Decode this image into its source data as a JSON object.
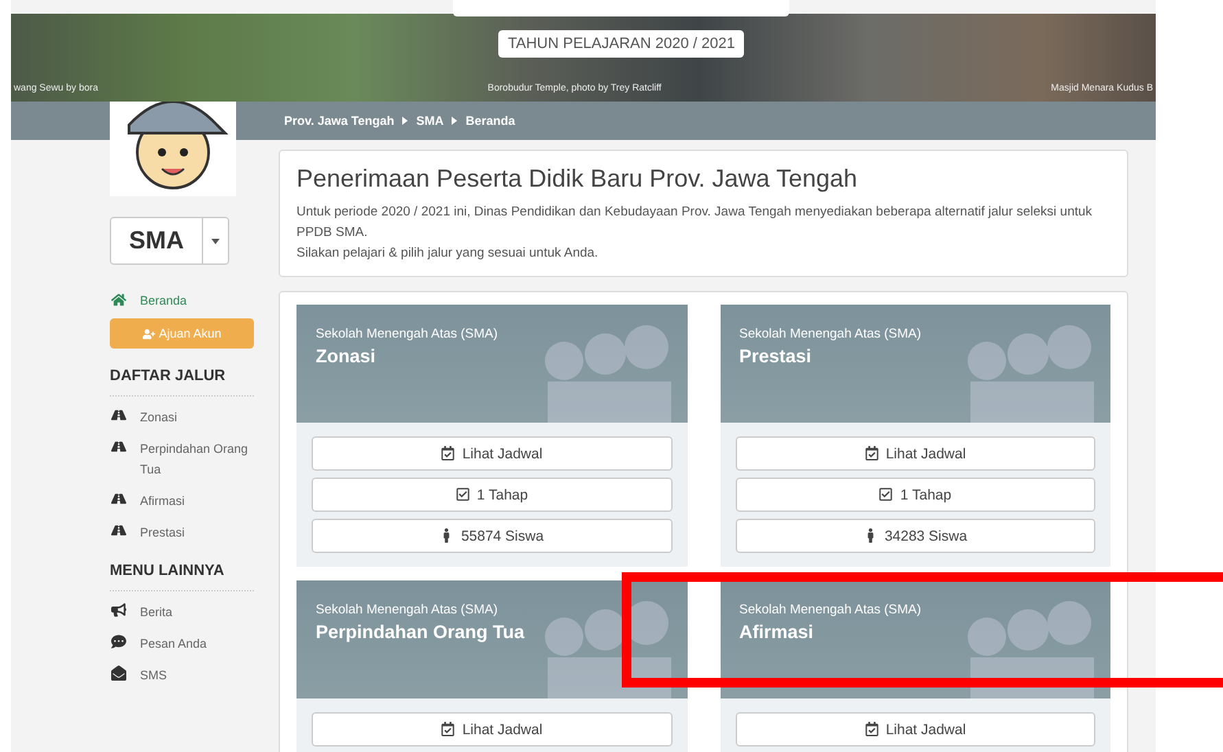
{
  "banner": {
    "title": "TAHUN PELAJARAN 2020 / 2021",
    "captions": [
      "wang Sewu by bora",
      "Borobudur Temple, photo by Trey Ratcliff",
      "Masjid Menara Kudus B"
    ]
  },
  "breadcrumb": [
    "Prov. Jawa Tengah",
    "SMA",
    "Beranda"
  ],
  "sidebar": {
    "level_select": "SMA",
    "nav": [
      {
        "label": "Beranda",
        "selected": true
      }
    ],
    "account_button": "Ajuan Akun",
    "sections": [
      {
        "title": "DAFTAR JALUR",
        "items": [
          {
            "kind": "road",
            "label": "Zonasi"
          },
          {
            "kind": "road",
            "label": "Perpindahan Orang Tua"
          },
          {
            "kind": "road",
            "label": "Afirmasi"
          },
          {
            "kind": "road",
            "label": "Prestasi"
          }
        ]
      },
      {
        "title": "MENU LAINNYA",
        "items": [
          {
            "kind": "megaphone",
            "label": "Berita"
          },
          {
            "kind": "chat",
            "label": "Pesan Anda"
          },
          {
            "kind": "envelope",
            "label": "SMS"
          }
        ]
      }
    ]
  },
  "intro": {
    "title": "Penerimaan Peserta Didik Baru Prov. Jawa Tengah",
    "lines": [
      "Untuk periode 2020 / 2021 ini, Dinas Pendidikan dan Kebudayaan Prov. Jawa Tengah menyediakan beberapa alternatif jalur seleksi untuk PPDB SMA.",
      "Silakan pelajari & pilih jalur yang sesuai untuk Anda."
    ]
  },
  "cards": [
    {
      "subtitle": "Sekolah Menengah Atas (SMA)",
      "title": "Zonasi",
      "buttons": [
        {
          "kind": "calendar",
          "label": "Lihat Jadwal"
        },
        {
          "kind": "check",
          "label": "1 Tahap"
        },
        {
          "kind": "person",
          "label": "55874 Siswa"
        }
      ]
    },
    {
      "subtitle": "Sekolah Menengah Atas (SMA)",
      "title": "Prestasi",
      "buttons": [
        {
          "kind": "calendar",
          "label": "Lihat Jadwal"
        },
        {
          "kind": "check",
          "label": "1 Tahap"
        },
        {
          "kind": "person",
          "label": "34283 Siswa"
        }
      ]
    },
    {
      "subtitle": "Sekolah Menengah Atas (SMA)",
      "title": "Perpindahan Orang Tua",
      "buttons": [
        {
          "kind": "calendar",
          "label": "Lihat Jadwal"
        }
      ]
    },
    {
      "subtitle": "Sekolah Menengah Atas (SMA)",
      "title": "Afirmasi",
      "buttons": [
        {
          "kind": "calendar",
          "label": "Lihat Jadwal"
        }
      ]
    }
  ]
}
